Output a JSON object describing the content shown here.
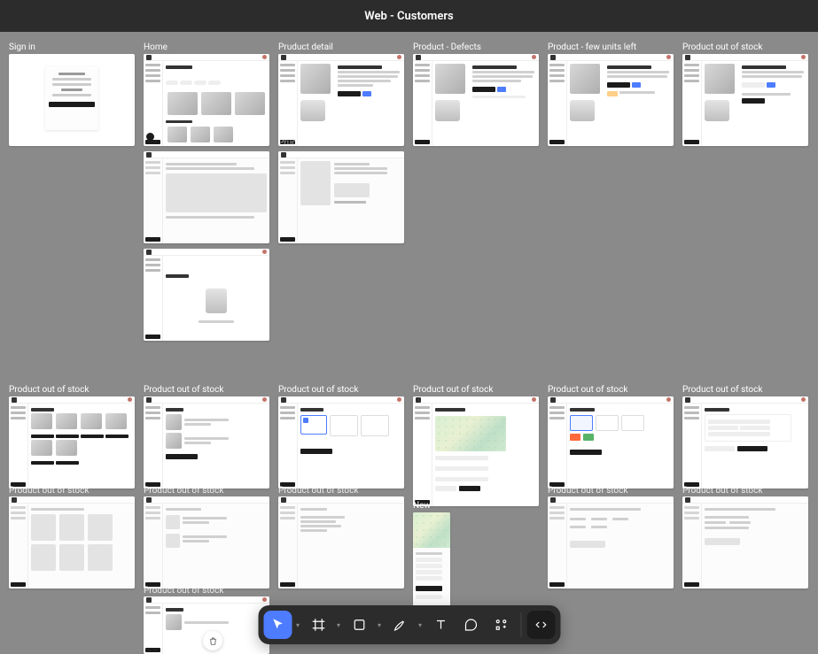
{
  "header": {
    "title": "Web - Customers"
  },
  "labels": {
    "signin": "Sign in",
    "home": "Home",
    "pdetail": "Pruduct detail",
    "pdetail2": "Pruduct detail",
    "pdefects": "Product - Defects",
    "pfew": "Product - few units left",
    "poos": "Product out of stock",
    "new": "New"
  },
  "toolbar": {
    "move": "Move",
    "frame": "Frame",
    "shape": "Shape",
    "pen": "Pen",
    "text": "Text",
    "comment": "Comment",
    "actions": "Actions",
    "dev": "Dev Mode"
  }
}
